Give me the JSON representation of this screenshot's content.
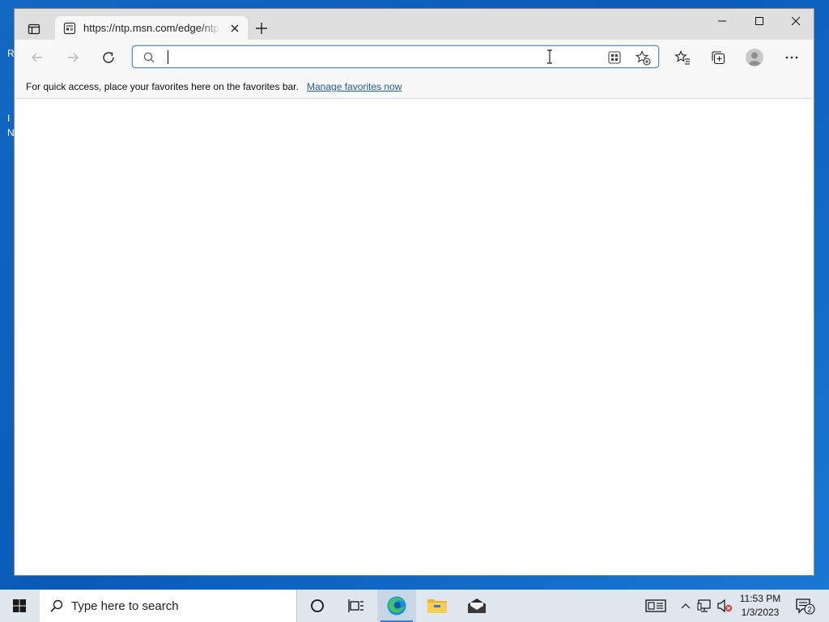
{
  "desktop": {
    "edge_chars": [
      "R",
      "I",
      "N"
    ]
  },
  "browser": {
    "tab": {
      "title": "https://ntp.msn.com/edge/ntp?locale=en-US"
    },
    "address_bar": {
      "value": "",
      "placeholder": ""
    },
    "favorites_bar": {
      "message": "For quick access, place your favorites here on the favorites bar.",
      "link": "Manage favorites now"
    }
  },
  "taskbar": {
    "search_placeholder": "Type here to search",
    "clock": {
      "time": "11:53 PM",
      "date": "1/3/2023"
    },
    "notification_count": "2"
  },
  "colors": {
    "accent": "#3d7cd0",
    "link": "#1a5fa8",
    "taskbar": "#dfe6ee"
  }
}
